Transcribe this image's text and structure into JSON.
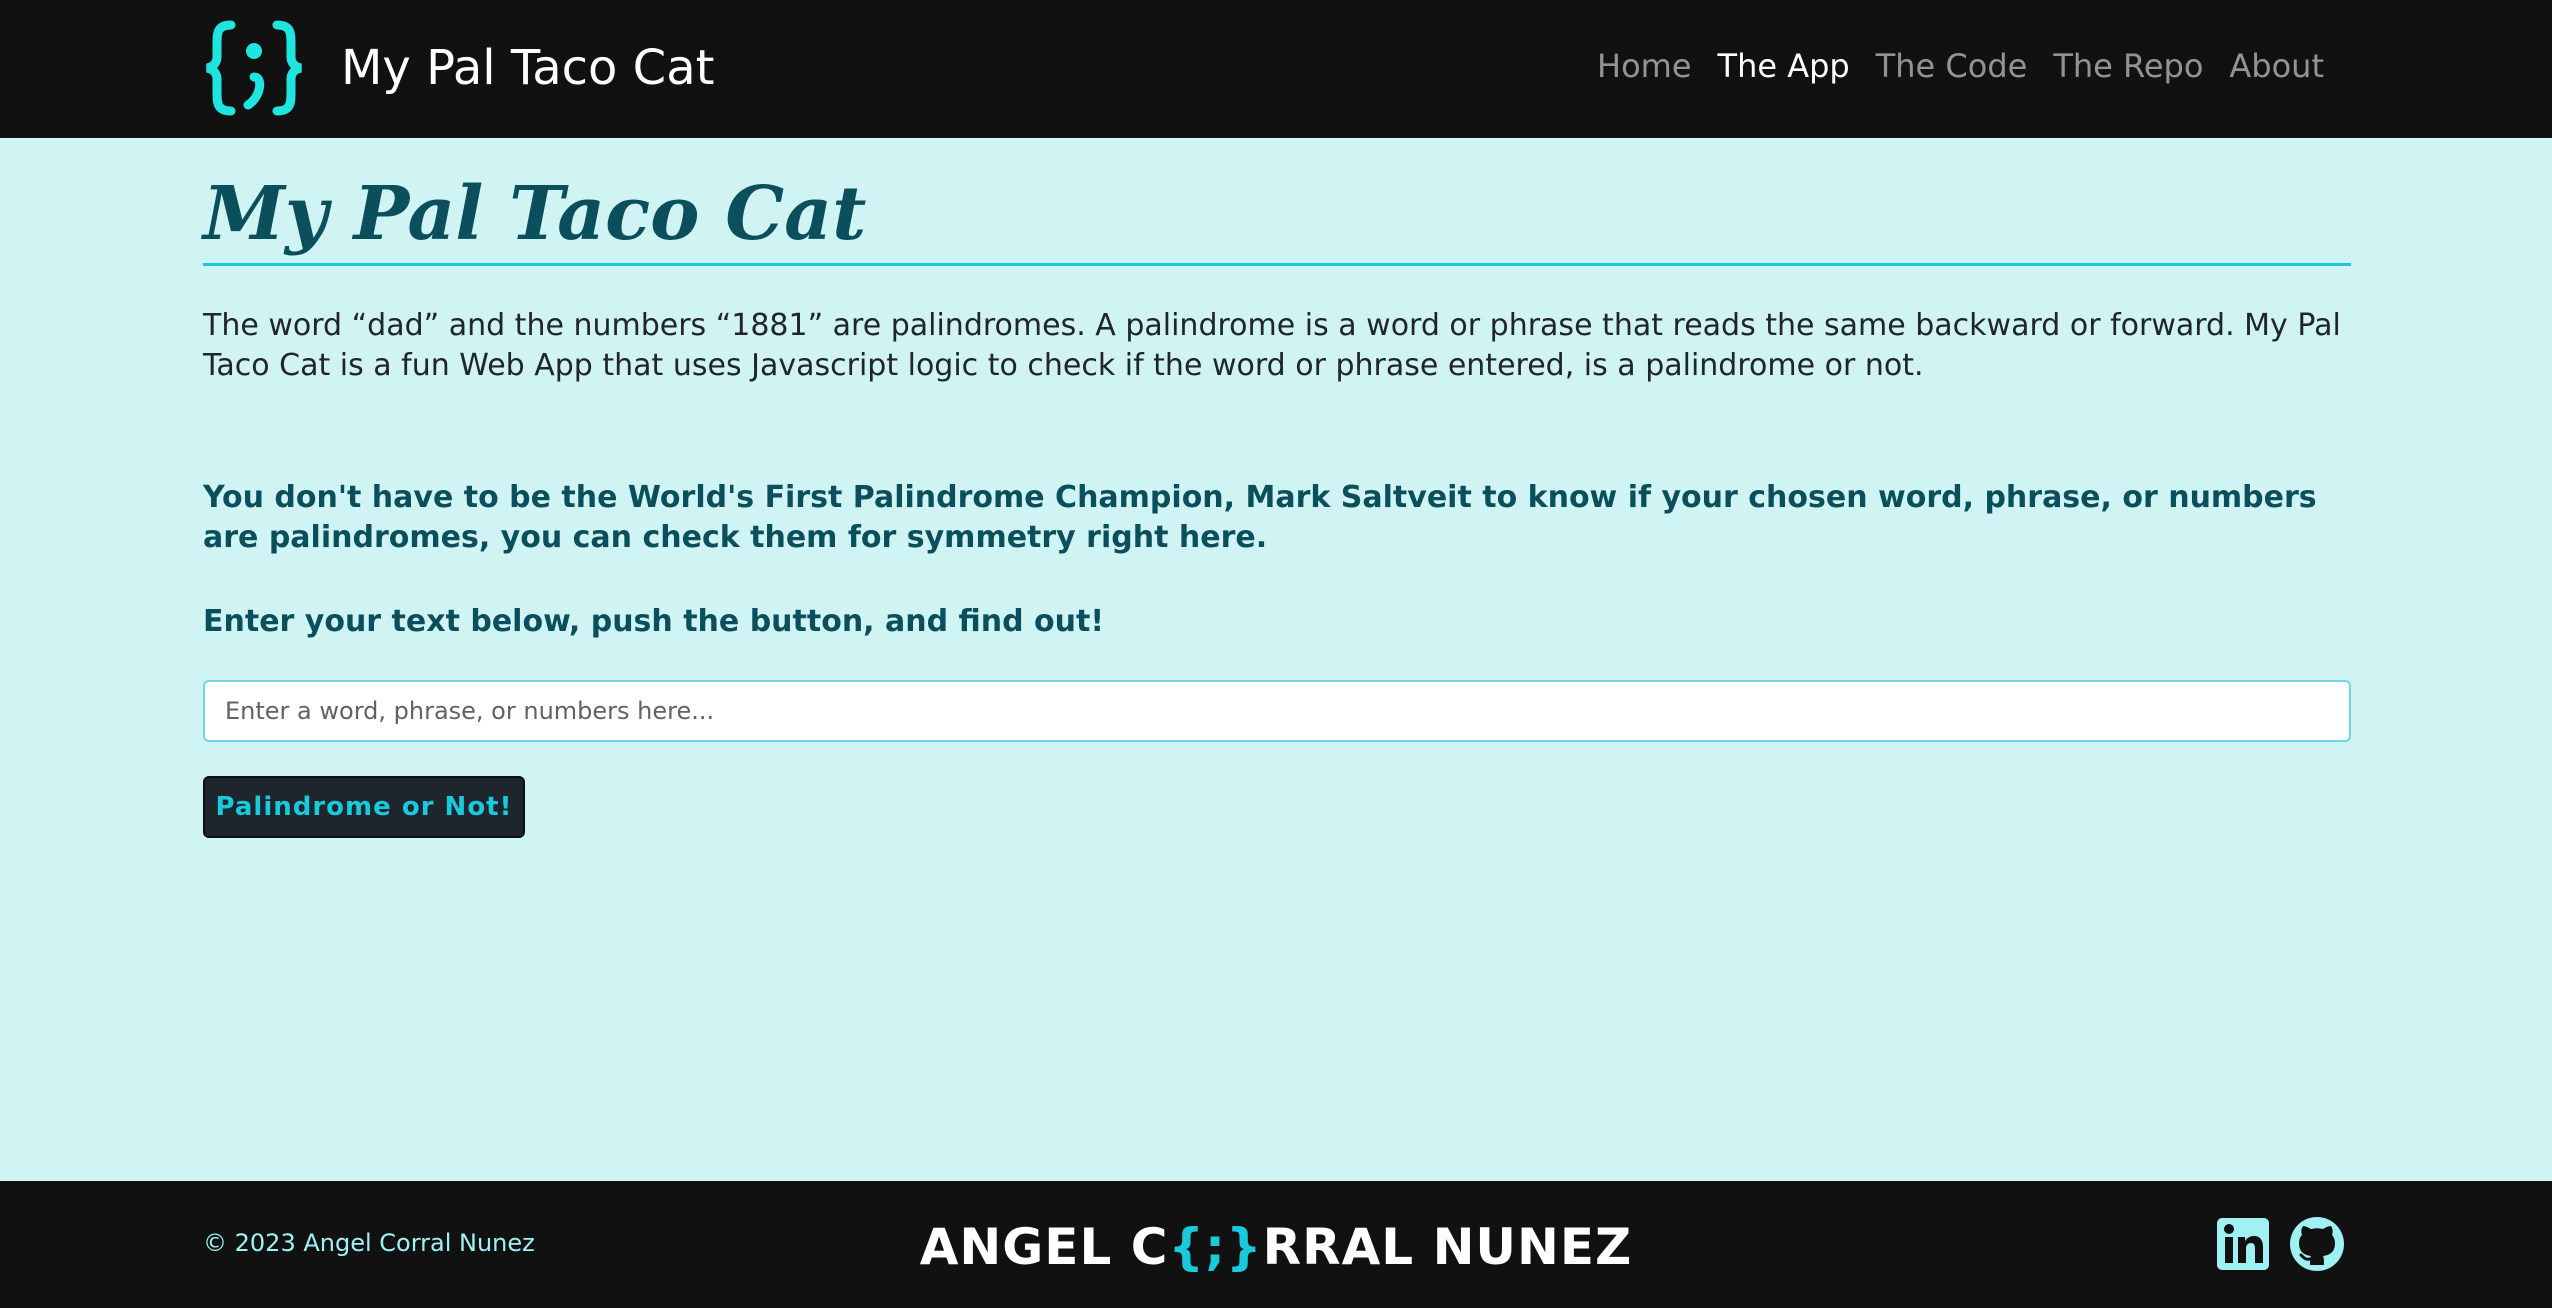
{
  "navbar": {
    "brand_logo_icon": "curly-braces-semicolon-icon",
    "brand_name": "My Pal Taco Cat",
    "accent_color": "#1fe5df",
    "links": [
      {
        "label": "Home",
        "active": false
      },
      {
        "label": "The App",
        "active": true
      },
      {
        "label": "The Code",
        "active": false
      },
      {
        "label": "The Repo",
        "active": false
      },
      {
        "label": "About",
        "active": false
      }
    ]
  },
  "main": {
    "title": "My Pal Taco Cat",
    "intro": "The word “dad” and the numbers “1881” are palindromes. A palindrome is a word or phrase that reads the same backward or forward. My Pal Taco Cat is a fun Web App that uses Javascript logic to check if the word or phrase entered, is a palindrome or not.",
    "lead": "You don't have to be the World's First Palindrome Champion, Mark Saltveit to know if your chosen word, phrase, or numbers are palindromes, you can check them for symmetry right here.",
    "cta": "Enter your text below, push the button, and find out!",
    "input": {
      "value": "",
      "placeholder": "Enter a word, phrase, or numbers here..."
    },
    "button_label": "Palindrome or Not!"
  },
  "footer": {
    "copyright": "© 2023 Angel Corral Nunez",
    "brand_prefix": "ANGEL C",
    "brand_braces": "{;}",
    "brand_suffix": "RRAL NUNEZ",
    "social": [
      {
        "icon": "linkedin-icon",
        "color": "#9ff1f4"
      },
      {
        "icon": "github-icon",
        "color": "#9ff1f4"
      }
    ]
  }
}
